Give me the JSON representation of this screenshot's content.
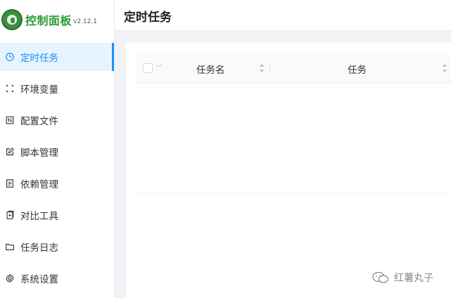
{
  "brand": {
    "title": "控制面板",
    "version": "v2.12.1"
  },
  "sidebar": {
    "items": [
      {
        "label": "定时任务",
        "icon": "clock-icon",
        "active": true
      },
      {
        "label": "环境变量",
        "icon": "env-icon",
        "active": false
      },
      {
        "label": "配置文件",
        "icon": "config-icon",
        "active": false
      },
      {
        "label": "脚本管理",
        "icon": "edit-icon",
        "active": false
      },
      {
        "label": "依赖管理",
        "icon": "file-icon",
        "active": false
      },
      {
        "label": "对比工具",
        "icon": "diff-icon",
        "active": false
      },
      {
        "label": "任务日志",
        "icon": "folder-icon",
        "active": false
      },
      {
        "label": "系统设置",
        "icon": "gear-icon",
        "active": false
      }
    ]
  },
  "header": {
    "title": "定时任务"
  },
  "table": {
    "columns": [
      "任务名",
      "任务"
    ]
  },
  "watermark": {
    "text": "红薯丸子"
  },
  "colors": {
    "brand": "#2f9a36",
    "accent": "#1890ff",
    "active_bg": "#e6f4ff"
  }
}
